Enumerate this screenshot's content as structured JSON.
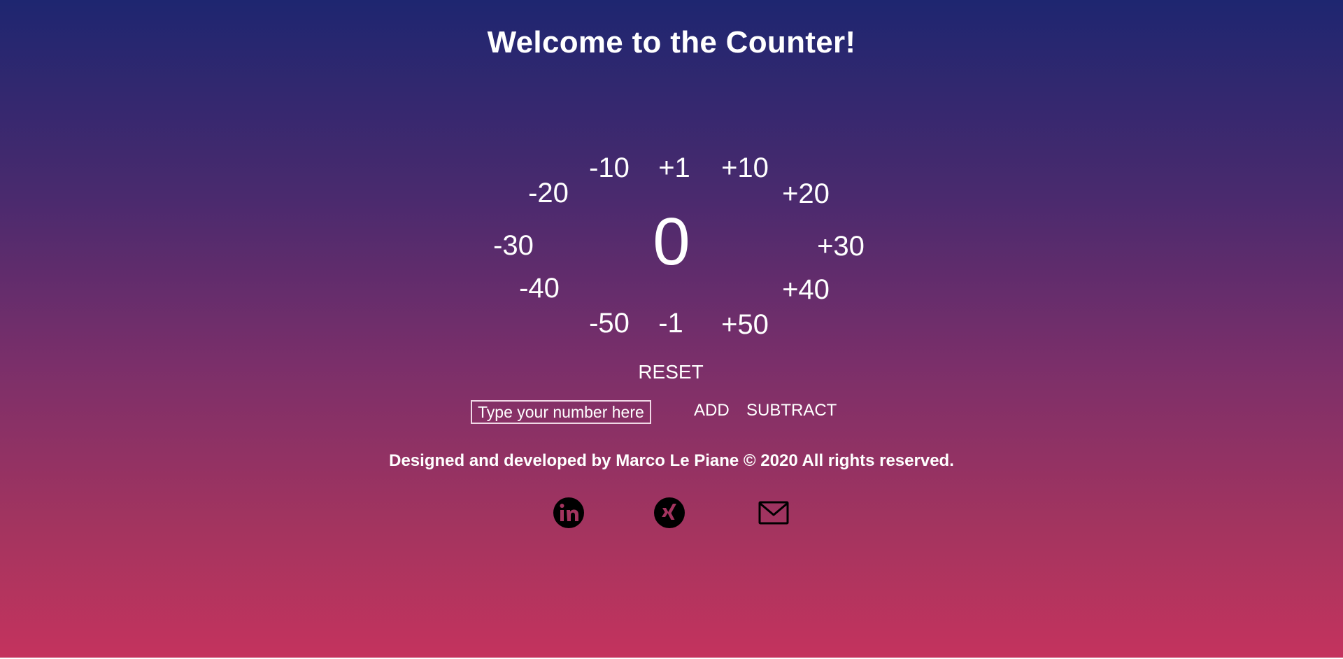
{
  "header": {
    "title": "Welcome to the Counter!"
  },
  "counter": {
    "value": "0",
    "buttons": {
      "minus10": "-10",
      "plus1": "+1",
      "plus10": "+10",
      "minus20": "-20",
      "plus20": "+20",
      "minus30": "-30",
      "plus30": "+30",
      "minus40": "-40",
      "plus40": "+40",
      "minus50": "-50",
      "minus1": "-1",
      "plus50": "+50"
    },
    "reset_label": "RESET"
  },
  "custom": {
    "placeholder": "Type your number here",
    "add_label": "ADD",
    "subtract_label": "SUBTRACT"
  },
  "footer": {
    "text": "Designed and developed by Marco Le Piane © 2020 All rights reserved.",
    "social": [
      {
        "name": "linkedin-icon"
      },
      {
        "name": "xing-icon"
      },
      {
        "name": "mail-icon"
      }
    ]
  },
  "colors": {
    "gradient_top": "#1e2670",
    "gradient_bottom": "#c4335e",
    "text": "#ffffff"
  }
}
